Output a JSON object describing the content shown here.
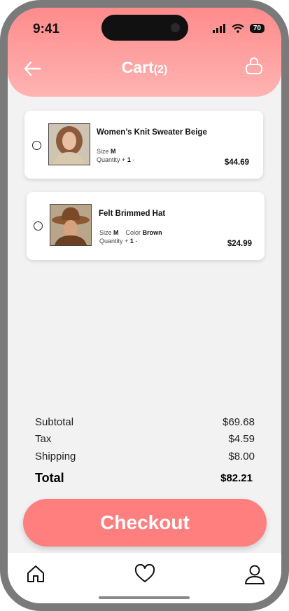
{
  "status_bar": {
    "time": "9:41",
    "battery": "70"
  },
  "header": {
    "title": "Cart",
    "count": "(2)"
  },
  "cart_items": [
    {
      "name": "Women’s Knit Sweater Beige",
      "size_label": "Size",
      "size": "M",
      "quantity_label": "Quantity",
      "quantity_plus": "+",
      "quantity": "1",
      "quantity_minus": "-",
      "price": "$44.69"
    },
    {
      "name": "Felt Brimmed Hat",
      "size_label": "Size",
      "size": "M",
      "color_label": "Color",
      "color": "Brown",
      "quantity_label": "Quantity",
      "quantity_plus": "+",
      "quantity": "1",
      "quantity_minus": "-",
      "price": "$24.99"
    }
  ],
  "summary": {
    "subtotal_label": "Subtotal",
    "subtotal": "$69.68",
    "tax_label": "Tax",
    "tax": "$4.59",
    "shipping_label": "Shipping",
    "shipping": "$8.00",
    "total_label": "Total",
    "total": "$82.21"
  },
  "checkout_label": "Checkout",
  "tabs": [
    {
      "icon": "home-icon"
    },
    {
      "icon": "heart-icon"
    },
    {
      "icon": "profile-icon"
    }
  ],
  "colors": {
    "accent": "#ff7e7e",
    "header_top": "#ff8b8b",
    "header_bottom": "#ffb3b3"
  }
}
